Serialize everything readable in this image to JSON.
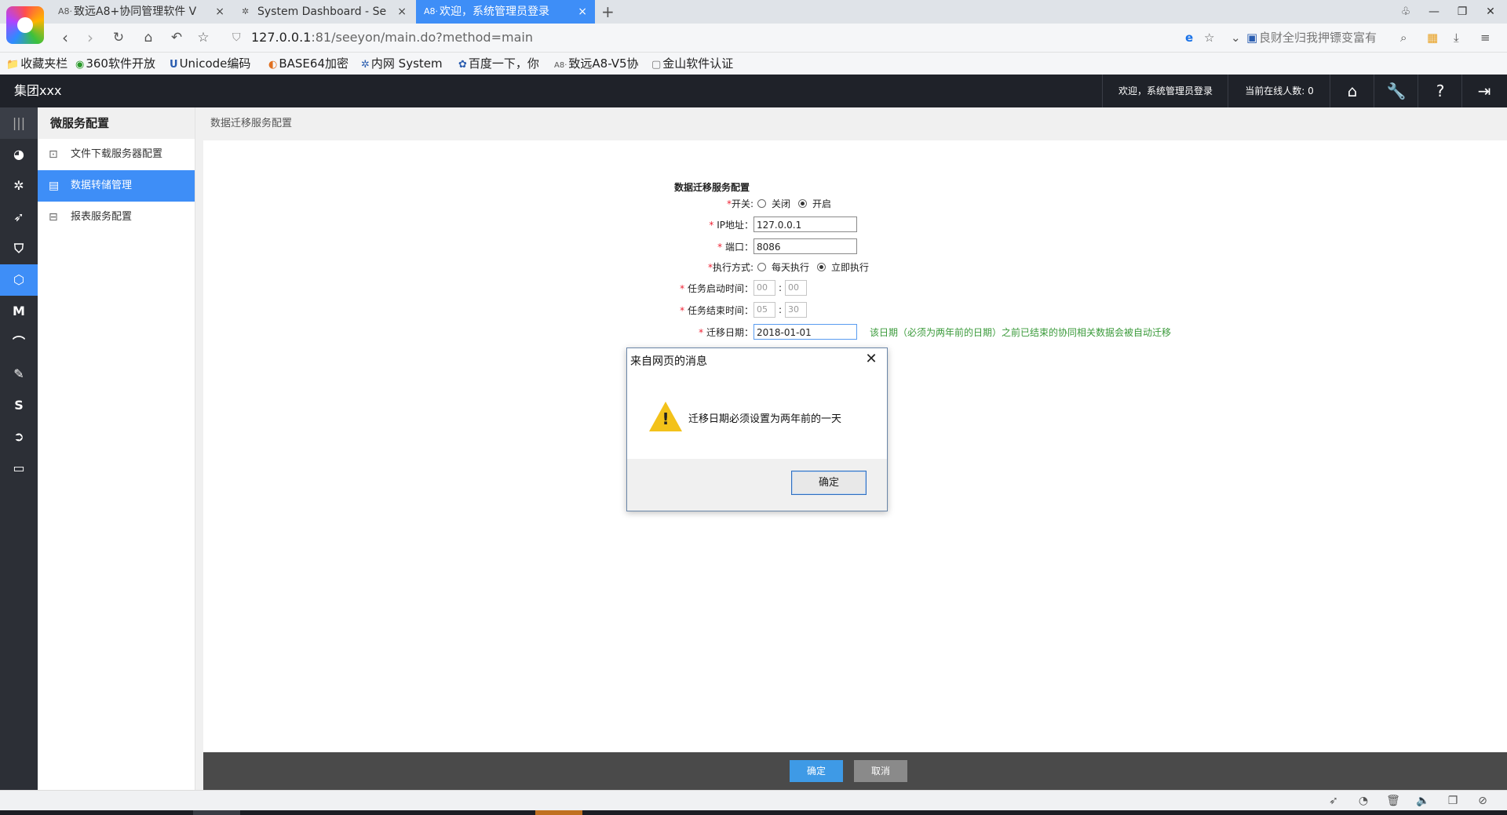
{
  "browser": {
    "tabs": [
      {
        "favicon": "A8·",
        "title": "致远A8+协同管理软件 V",
        "close": "×"
      },
      {
        "favicon": "✲",
        "title": "System Dashboard - Se",
        "close": "×"
      },
      {
        "favicon": "A8·",
        "title": "欢迎，系统管理员登录",
        "close": "×"
      }
    ],
    "new_tab": "+",
    "window_controls": {
      "skin": "♧",
      "minimize": "—",
      "restore": "❐",
      "close": "✕"
    },
    "address": {
      "host": "127.0.0.1",
      "rest": ":81/seeyon/main.do?method=main"
    },
    "search_hint": "良财全归我押镖变富有",
    "bookmarks": [
      {
        "icon": "folder-icon",
        "glyph": "📁",
        "label": "收藏夹栏"
      },
      {
        "icon": "360-icon",
        "glyph": "◉",
        "label": "360软件开放"
      },
      {
        "icon": "unicode-icon",
        "glyph": "U",
        "label": "Unicode编码"
      },
      {
        "icon": "base64-icon",
        "glyph": "◐",
        "label": "BASE64加密"
      },
      {
        "icon": "system-icon",
        "glyph": "✲",
        "label": "内网 System"
      },
      {
        "icon": "baidu-icon",
        "glyph": "✿",
        "label": "百度一下，你"
      },
      {
        "icon": "a8-icon",
        "glyph": "A8·",
        "label": "致远A8-V5协"
      },
      {
        "icon": "doc-icon",
        "glyph": "▢",
        "label": "金山软件认证"
      }
    ]
  },
  "app": {
    "org": "集团xxx",
    "welcome": "欢迎，系统管理员登录",
    "online": "当前在线人数: 0",
    "header_icons": [
      "home-icon",
      "wrench-icon",
      "help-icon",
      "logout-icon"
    ]
  },
  "rail": {
    "icons": [
      "menu-icon",
      "dashboard-icon",
      "settings-icon",
      "rocket-icon",
      "shield-icon",
      "hexagon-icon",
      "m-icon",
      "curve-icon",
      "pen-icon",
      "s-icon",
      "forward-icon",
      "monitor-icon"
    ]
  },
  "submenu": {
    "title": "微服务配置",
    "items": [
      {
        "label": "文件下载服务器配置",
        "icon": "download-icon"
      },
      {
        "label": "数据转储管理",
        "icon": "storage-icon"
      },
      {
        "label": "报表服务配置",
        "icon": "report-icon"
      }
    ]
  },
  "breadcrumb": "数据迁移服务配置",
  "form": {
    "title": "数据迁移服务配置",
    "switch": {
      "label": "开关:",
      "off": "关闭",
      "on": "开启",
      "selected": "开启"
    },
    "ip": {
      "label": "IP地址：",
      "value": "127.0.0.1"
    },
    "port": {
      "label": "端口：",
      "value": "8086"
    },
    "mode": {
      "label": "执行方式:",
      "daily": "每天执行",
      "now": "立即执行",
      "selected": "立即执行"
    },
    "start_time": {
      "label": "任务启动时间：",
      "hour": "00",
      "minute": "00"
    },
    "end_time": {
      "label": "任务结束时间：",
      "hour": "05",
      "minute": "30"
    },
    "date": {
      "label": "迁移日期：",
      "value": "2018-01-01"
    },
    "hint": "该日期（必须为两年前的日期）之前已结束的协同相关数据会被自动迁移"
  },
  "actions": {
    "ok": "确定",
    "cancel": "取消"
  },
  "dialog": {
    "title": "来自网页的消息",
    "message": "迁移日期必须设置为两年前的一天",
    "ok": "确定",
    "close": "✕"
  },
  "colors": {
    "accent": "#3e8ef7",
    "header_bg": "#1f2229",
    "rail_bg": "#2c2f36",
    "hint_green": "#3a9a3a"
  }
}
